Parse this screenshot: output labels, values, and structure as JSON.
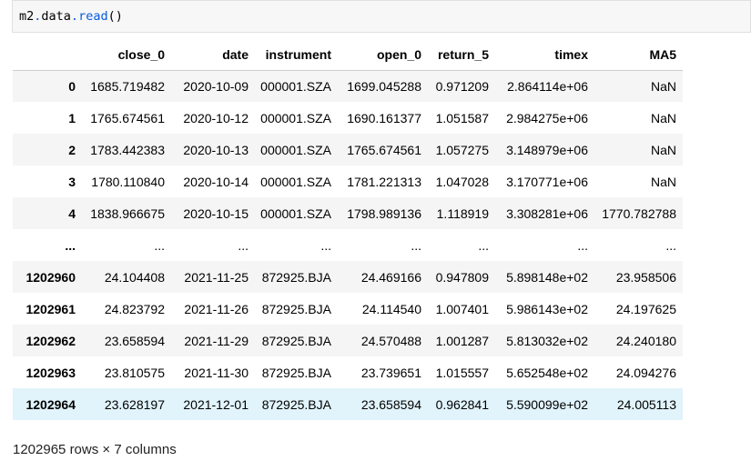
{
  "code": {
    "obj": "m2",
    "attr1": "data",
    "attr2": "read",
    "parens": "()"
  },
  "table": {
    "columns": [
      "",
      "close_0",
      "date",
      "instrument",
      "open_0",
      "return_5",
      "timex",
      "MA5"
    ],
    "rows": [
      [
        "0",
        "1685.719482",
        "2020-10-09",
        "000001.SZA",
        "1699.045288",
        "0.971209",
        "2.864114e+06",
        "NaN"
      ],
      [
        "1",
        "1765.674561",
        "2020-10-12",
        "000001.SZA",
        "1690.161377",
        "1.051587",
        "2.984275e+06",
        "NaN"
      ],
      [
        "2",
        "1783.442383",
        "2020-10-13",
        "000001.SZA",
        "1765.674561",
        "1.057275",
        "3.148979e+06",
        "NaN"
      ],
      [
        "3",
        "1780.110840",
        "2020-10-14",
        "000001.SZA",
        "1781.221313",
        "1.047028",
        "3.170771e+06",
        "NaN"
      ],
      [
        "4",
        "1838.966675",
        "2020-10-15",
        "000001.SZA",
        "1798.989136",
        "1.118919",
        "3.308281e+06",
        "1770.782788"
      ],
      [
        "...",
        "...",
        "...",
        "...",
        "...",
        "...",
        "...",
        "..."
      ],
      [
        "1202960",
        "24.104408",
        "2021-11-25",
        "872925.BJA",
        "24.469166",
        "0.947809",
        "5.898148e+02",
        "23.958506"
      ],
      [
        "1202961",
        "24.823792",
        "2021-11-26",
        "872925.BJA",
        "24.114540",
        "1.007401",
        "5.986143e+02",
        "24.197625"
      ],
      [
        "1202962",
        "23.658594",
        "2021-11-29",
        "872925.BJA",
        "24.570488",
        "1.001287",
        "5.813032e+02",
        "24.240180"
      ],
      [
        "1202963",
        "23.810575",
        "2021-11-30",
        "872925.BJA",
        "23.739651",
        "1.015557",
        "5.652548e+02",
        "24.094276"
      ],
      [
        "1202964",
        "23.628197",
        "2021-12-01",
        "872925.BJA",
        "23.658594",
        "0.962841",
        "5.590099e+02",
        "24.005113"
      ]
    ],
    "hovered_row": 10
  },
  "footer": {
    "shape_text": "1202965 rows × 7 columns"
  },
  "colors": {
    "code_bg": "#f7f7f7",
    "row_stripe": "#f5f5f5",
    "row_hover": "#e1f3fb"
  }
}
